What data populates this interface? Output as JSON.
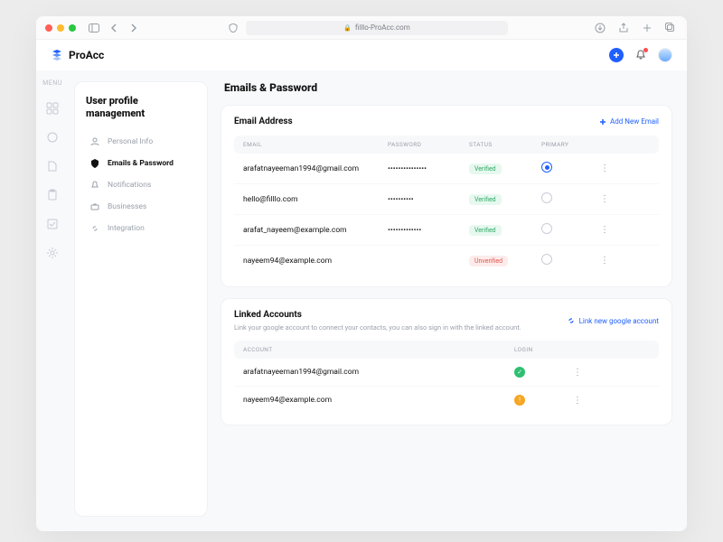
{
  "browser": {
    "url": "filllo-ProAcc.com"
  },
  "app": {
    "name": "ProAcc"
  },
  "rail": {
    "label": "MENU"
  },
  "settingsNav": {
    "title": "User profile management",
    "items": [
      {
        "label": "Personal Info"
      },
      {
        "label": "Emails & Password"
      },
      {
        "label": "Notifications"
      },
      {
        "label": "Businesses"
      },
      {
        "label": "Integration"
      }
    ]
  },
  "page": {
    "title": "Emails & Password"
  },
  "emailCard": {
    "title": "Email Address",
    "action": "Add New Email",
    "columns": {
      "c1": "Email",
      "c2": "Password",
      "c3": "Status",
      "c4": "Primary"
    },
    "rows": [
      {
        "email": "arafatnayeeman1994@gmail.com",
        "password": "•••••••••••••••",
        "status": "Verified",
        "statusKind": "verified",
        "primary": true
      },
      {
        "email": "hello@filllo.com",
        "password": "••••••••••",
        "status": "Verified",
        "statusKind": "verified",
        "primary": false
      },
      {
        "email": "arafat_nayeem@example.com",
        "password": "•••••••••••••",
        "status": "Verified",
        "statusKind": "verified",
        "primary": false
      },
      {
        "email": "nayeem94@example.com",
        "password": "",
        "status": "Unverified",
        "statusKind": "unverified",
        "primary": false
      }
    ]
  },
  "linkedCard": {
    "title": "Linked Accounts",
    "subtitle": "Link your google account to connect your contacts, you can also sign in with the linked account.",
    "action": "Link new google account",
    "columns": {
      "c1": "Account",
      "c2": "Login"
    },
    "rows": [
      {
        "account": "arafatnayeeman1994@gmail.com",
        "login": "ok"
      },
      {
        "account": "nayeem94@example.com",
        "login": "warn"
      }
    ]
  }
}
